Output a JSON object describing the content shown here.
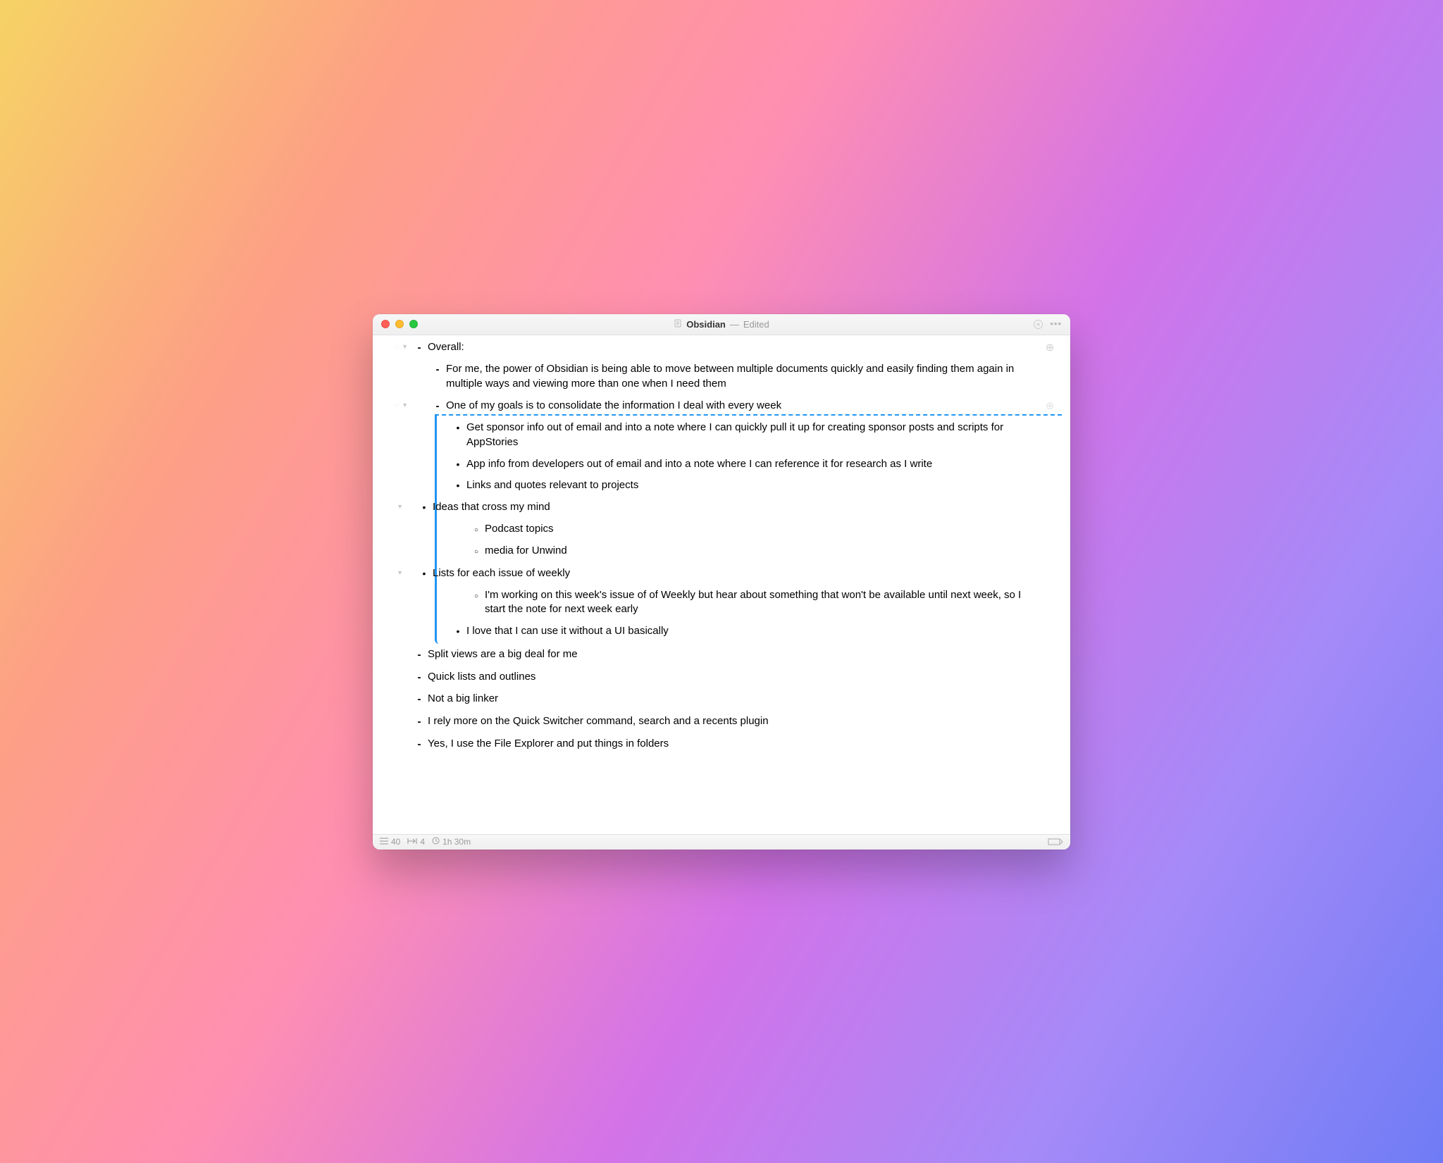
{
  "titlebar": {
    "doc_title": "Obsidian",
    "separator": "—",
    "status": "Edited"
  },
  "outline": {
    "overall_label": "Overall:",
    "power_text": "For me, the power of Obsidian is being able to move between multiple documents quickly and easily finding them again in multiple ways and viewing more than one when I need them",
    "goal_text": "One of my goals is to consolidate the information I deal with every week",
    "sponsor_text": "Get sponsor info out of email and into a note where I can quickly pull it up for creating sponsor posts and scripts for AppStories",
    "app_info_text": "App info from developers out of email and into a note where I can reference it for research as I write",
    "links_text": "Links and quotes relevant to projects",
    "ideas_text": "Ideas that cross my mind",
    "podcast_text": "Podcast topics",
    "media_text": "media for Unwind",
    "lists_text": "Lists for each issue of weekly",
    "weekly_issue_text": "I'm working on this week's issue of of Weekly but hear about something that won't be available until next week, so I start the note for next week early",
    "no_ui_text": "I love that I can use it without a UI basically",
    "split_views_text": "Split views are a big deal for me",
    "quick_lists_text": "Quick lists and outlines",
    "not_linker_text": "Not a big linker",
    "quick_switcher_text": "I rely more on the Quick Switcher command, search and a recents plugin",
    "file_explorer_text": "Yes, I use the File Explorer and put things in folders"
  },
  "statusbar": {
    "count1": "40",
    "count2": "4",
    "duration": "1h 30m"
  }
}
